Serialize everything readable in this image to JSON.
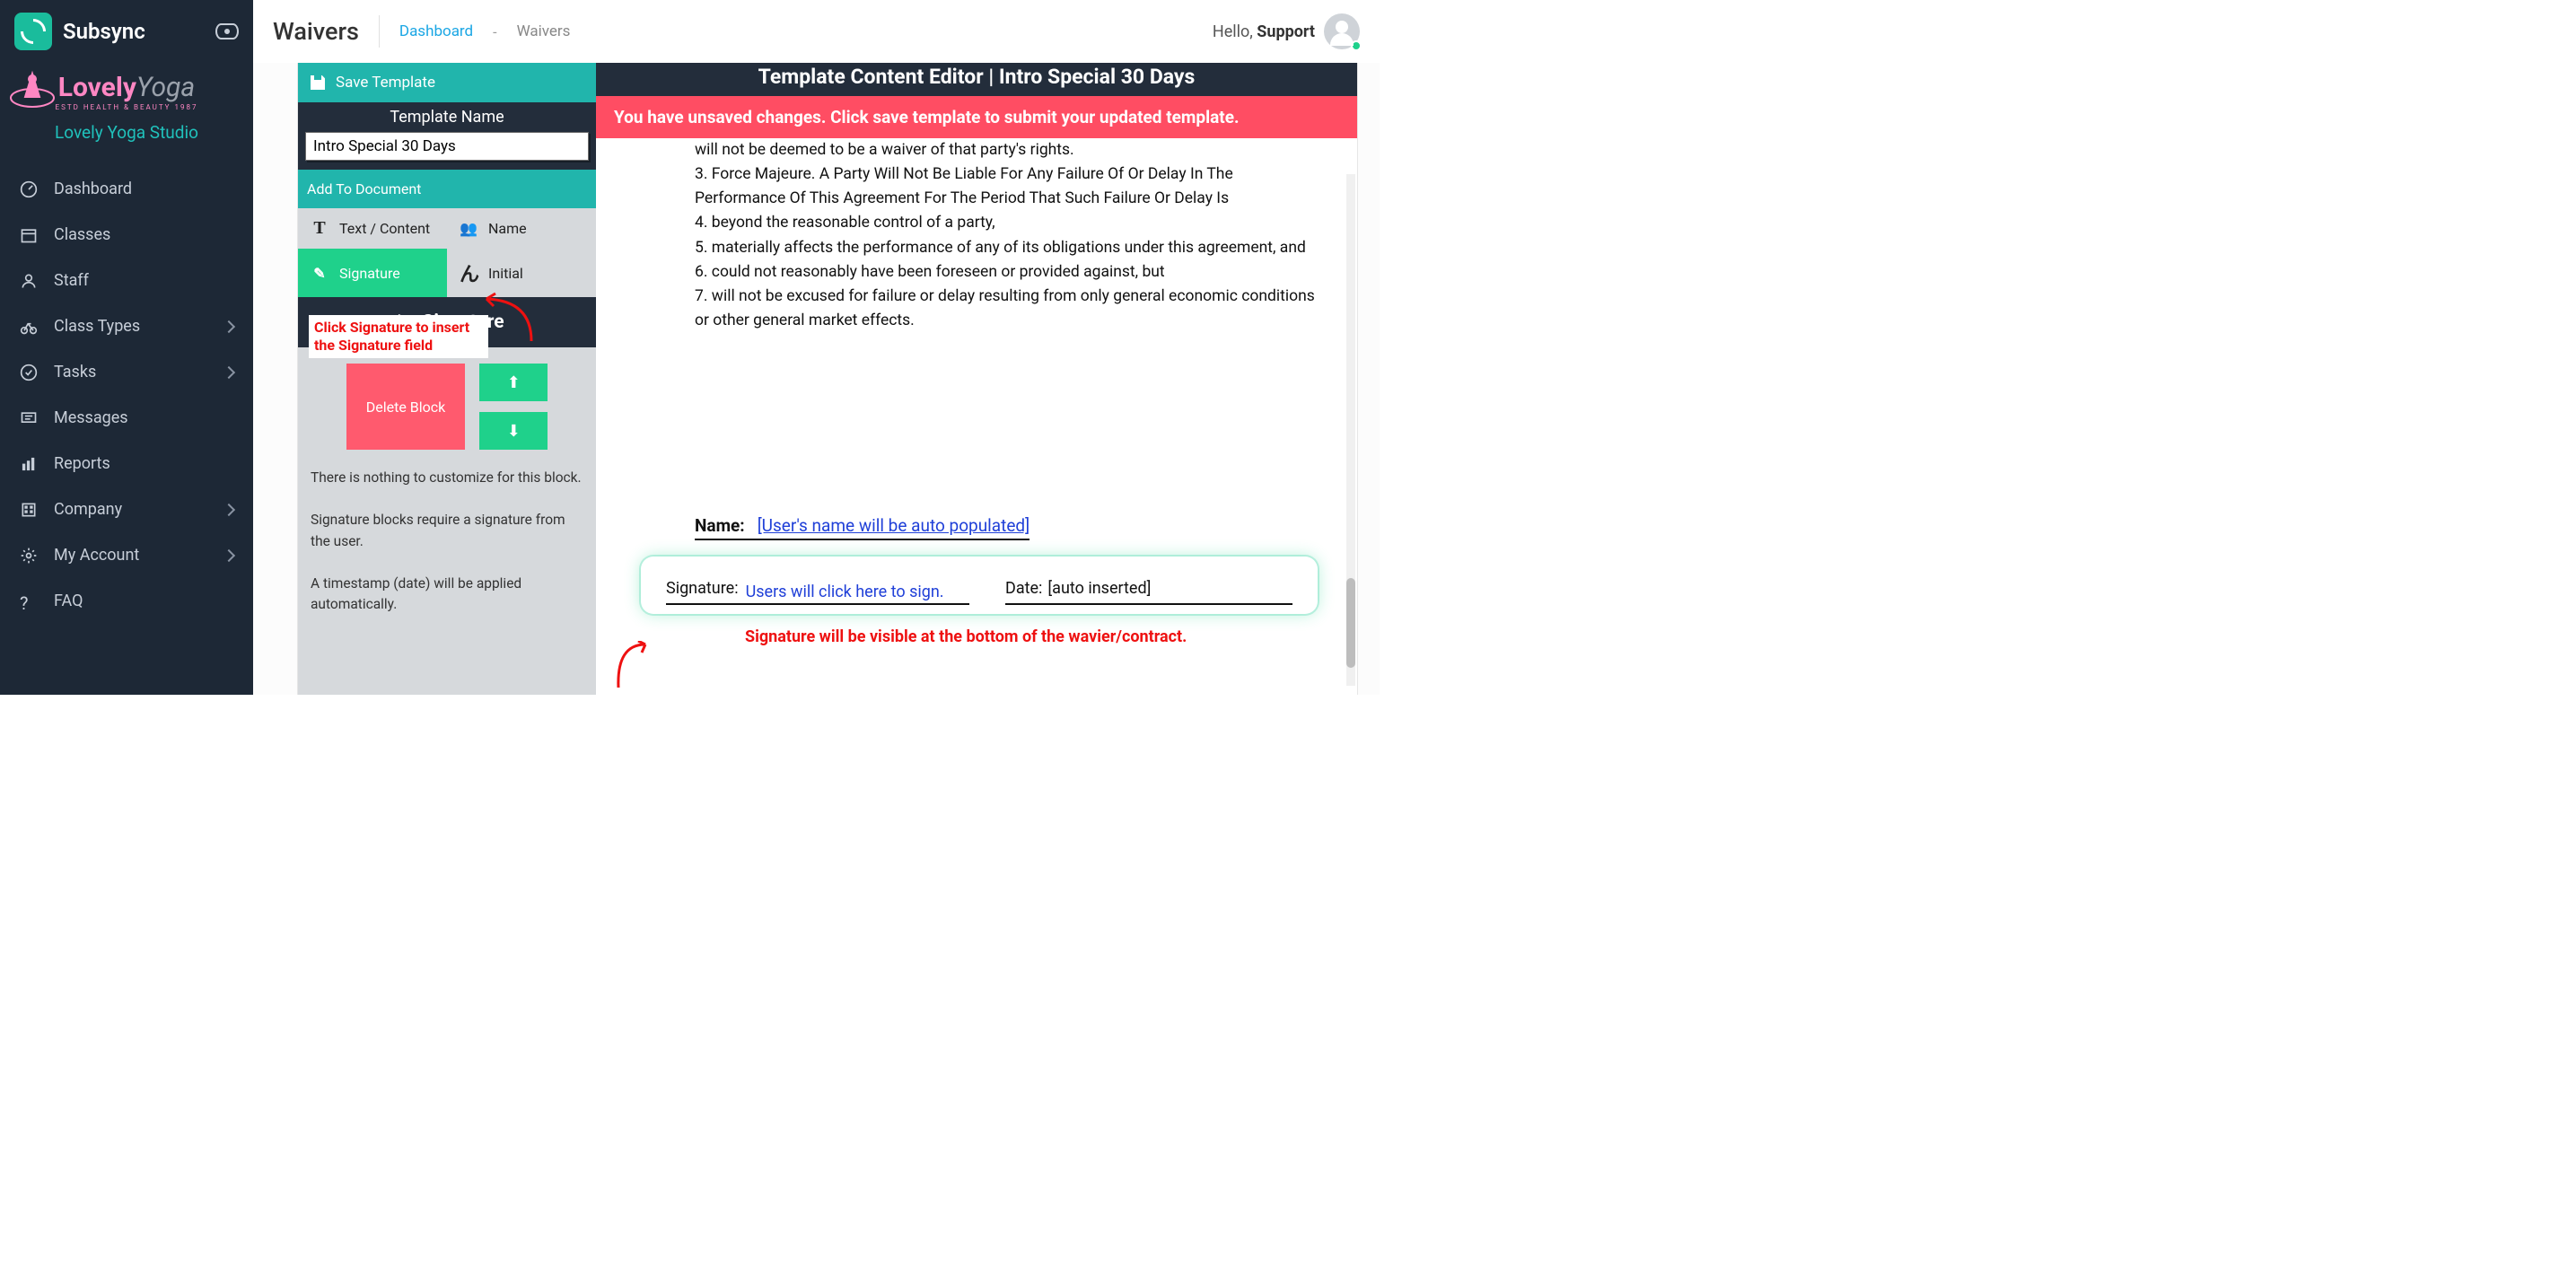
{
  "brand": "Subsync",
  "studio": {
    "logo_main": "Lovely",
    "logo_sub": "Yoga",
    "tagline": "ESTD HEALTH & BEAUTY 1987",
    "name": "Lovely Yoga Studio"
  },
  "nav": {
    "dashboard": "Dashboard",
    "classes": "Classes",
    "staff": "Staff",
    "class_types": "Class Types",
    "tasks": "Tasks",
    "messages": "Messages",
    "reports": "Reports",
    "company": "Company",
    "my_account": "My Account",
    "faq": "FAQ"
  },
  "header": {
    "page": "Waivers",
    "crumb_link": "Dashboard",
    "crumb_sep": "-",
    "crumb_current": "Waivers",
    "hello": "Hello,",
    "user": "Support"
  },
  "editor": {
    "title": "Template Content Editor | Intro Special 30 Days",
    "alert": "You have unsaved changes. Click save template to submit your updated template.",
    "save": "Save Template",
    "template_name_label": "Template Name",
    "template_name": "Intro Special 30 Days",
    "add_to_doc": "Add To Document",
    "tools": {
      "text": "Text / Content",
      "name": "Name",
      "signature": "Signature",
      "initial": "Initial"
    },
    "section_head": "Signature",
    "delete": "Delete Block",
    "help1": "There is nothing to customize for this block.",
    "help2": "Signature blocks require a signature from the user.",
    "help3": "A timestamp (date) will be applied automatically."
  },
  "annotations": {
    "click_sig": "Click Signature to insert the Signature field",
    "users_click": "Users will click here to sign.",
    "bottom": "Signature will be visible at the bottom of the wavier/contract."
  },
  "doc": {
    "lines": [
      "will not be deemed to be a waiver of that party's rights.",
      "3. Force Majeure. A Party Will Not Be Liable For Any Failure Of Or Delay In The Performance Of This Agreement For The Period That Such Failure Or Delay Is",
      "4. beyond the reasonable control of a party,",
      "5. materially affects the performance of any of its obligations under this agreement, and",
      "6. could not reasonably have been foreseen or provided against, but",
      "7. will not be excused for failure or delay resulting from only general economic conditions or other general market effects."
    ],
    "name_label": "Name:",
    "name_fill": "[User's name will be auto populated]",
    "sig_label": "Signature:",
    "date_label": "Date:",
    "date_fill": "[auto inserted]"
  }
}
